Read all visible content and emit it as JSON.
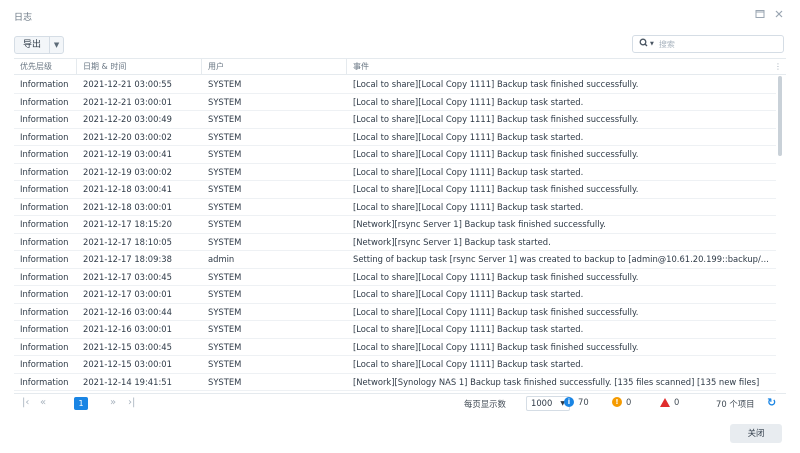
{
  "window": {
    "title": "日志",
    "maximize_icon": "maximize-icon",
    "close_icon": "close-icon"
  },
  "toolbar": {
    "export_label": "导出",
    "search_placeholder": "搜索"
  },
  "columns": [
    "优先层级",
    "日期 & 时间",
    "用户",
    "事件"
  ],
  "rows": [
    [
      "Information",
      "2021-12-21 03:00:55",
      "SYSTEM",
      "[Local to share][Local Copy 1111] Backup task finished successfully."
    ],
    [
      "Information",
      "2021-12-21 03:00:01",
      "SYSTEM",
      "[Local to share][Local Copy 1111] Backup task started."
    ],
    [
      "Information",
      "2021-12-20 03:00:49",
      "SYSTEM",
      "[Local to share][Local Copy 1111] Backup task finished successfully."
    ],
    [
      "Information",
      "2021-12-20 03:00:02",
      "SYSTEM",
      "[Local to share][Local Copy 1111] Backup task started."
    ],
    [
      "Information",
      "2021-12-19 03:00:41",
      "SYSTEM",
      "[Local to share][Local Copy 1111] Backup task finished successfully."
    ],
    [
      "Information",
      "2021-12-19 03:00:02",
      "SYSTEM",
      "[Local to share][Local Copy 1111] Backup task started."
    ],
    [
      "Information",
      "2021-12-18 03:00:41",
      "SYSTEM",
      "[Local to share][Local Copy 1111] Backup task finished successfully."
    ],
    [
      "Information",
      "2021-12-18 03:00:01",
      "SYSTEM",
      "[Local to share][Local Copy 1111] Backup task started."
    ],
    [
      "Information",
      "2021-12-17 18:15:20",
      "SYSTEM",
      "[Network][rsync Server 1] Backup task finished successfully."
    ],
    [
      "Information",
      "2021-12-17 18:10:05",
      "SYSTEM",
      "[Network][rsync Server 1] Backup task started."
    ],
    [
      "Information",
      "2021-12-17 18:09:38",
      "admin",
      "Setting of backup task [rsync Server 1] was created to backup to [admin@10.61.20.199::backup/..."
    ],
    [
      "Information",
      "2021-12-17 03:00:45",
      "SYSTEM",
      "[Local to share][Local Copy 1111] Backup task finished successfully."
    ],
    [
      "Information",
      "2021-12-17 03:00:01",
      "SYSTEM",
      "[Local to share][Local Copy 1111] Backup task started."
    ],
    [
      "Information",
      "2021-12-16 03:00:44",
      "SYSTEM",
      "[Local to share][Local Copy 1111] Backup task finished successfully."
    ],
    [
      "Information",
      "2021-12-16 03:00:01",
      "SYSTEM",
      "[Local to share][Local Copy 1111] Backup task started."
    ],
    [
      "Information",
      "2021-12-15 03:00:45",
      "SYSTEM",
      "[Local to share][Local Copy 1111] Backup task finished successfully."
    ],
    [
      "Information",
      "2021-12-15 03:00:01",
      "SYSTEM",
      "[Local to share][Local Copy 1111] Backup task started."
    ],
    [
      "Information",
      "2021-12-14 19:41:51",
      "SYSTEM",
      "[Network][Synology NAS 1] Backup task finished successfully. [135 files scanned] [135 new files]"
    ]
  ],
  "pager": {
    "current_page": "1",
    "per_page_label": "每页显示数",
    "per_page_value": "1000",
    "info_count": "70",
    "warning_count": "0",
    "error_count": "0",
    "total_label": "70 个项目"
  },
  "colors": {
    "accent": "#1a85e4",
    "info": "#1a85e4",
    "warning": "#f59b00",
    "error": "#e02c2c"
  },
  "footer": {
    "close_label": "关闭"
  }
}
